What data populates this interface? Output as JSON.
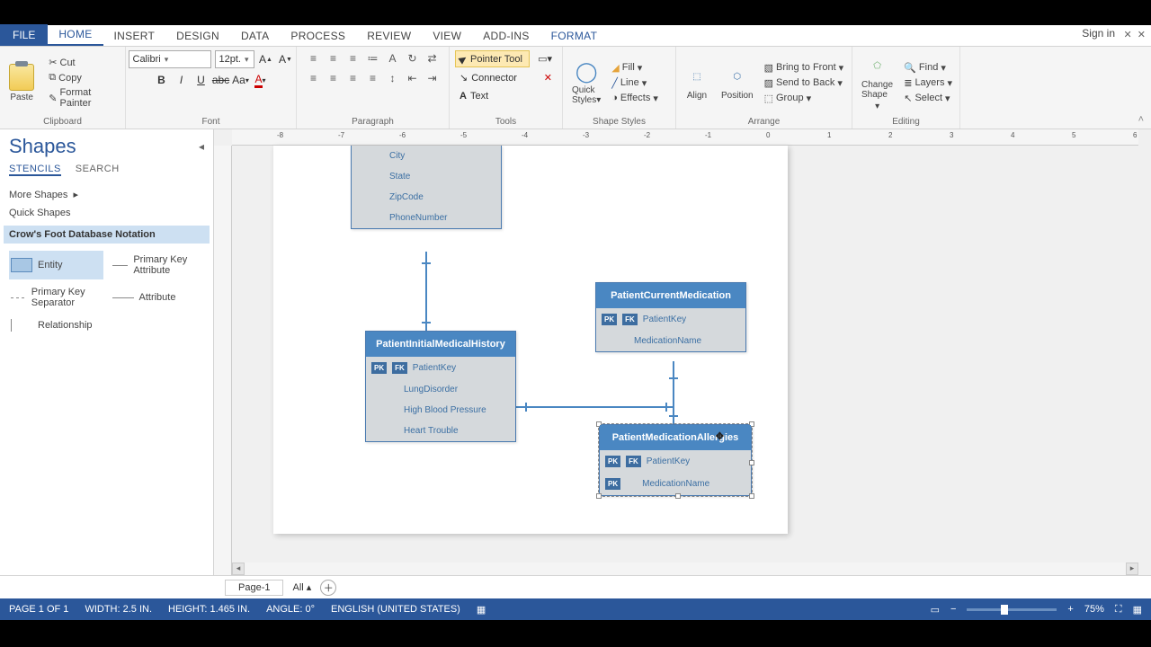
{
  "tabs": {
    "file": "FILE",
    "list": [
      "HOME",
      "INSERT",
      "DESIGN",
      "DATA",
      "PROCESS",
      "REVIEW",
      "VIEW",
      "ADD-INS",
      "FORMAT"
    ],
    "active": 0
  },
  "signin": "Sign in",
  "ribbon": {
    "clipboard": {
      "paste": "Paste",
      "cut": "Cut",
      "copy": "Copy",
      "painter": "Format Painter",
      "label": "Clipboard"
    },
    "font": {
      "name": "Calibri",
      "size": "12pt.",
      "label": "Font"
    },
    "paragraph": {
      "label": "Paragraph"
    },
    "tools": {
      "pointer": "Pointer Tool",
      "connector": "Connector",
      "text": "Text",
      "label": "Tools"
    },
    "shapestyles": {
      "fill": "Fill",
      "line": "Line",
      "effects": "Effects",
      "label": "Shape Styles"
    },
    "arrange": {
      "align": "Align",
      "position": "Position",
      "front": "Bring to Front",
      "back": "Send to Back",
      "group": "Group",
      "label": "Arrange"
    },
    "editing": {
      "change": "Change Shape",
      "find": "Find",
      "layers": "Layers",
      "select": "Select",
      "label": "Editing"
    }
  },
  "shapesPane": {
    "title": "Shapes",
    "tab1": "STENCILS",
    "tab2": "SEARCH",
    "more": "More Shapes",
    "quick": "Quick Shapes",
    "stencil": "Crow's Foot Database Notation",
    "items": [
      "Entity",
      "Primary Key Attribute",
      "Primary Key Separator",
      "Attribute",
      "Relationship"
    ]
  },
  "canvas": {
    "rulerMarks": [
      "-8",
      "-7",
      "-6",
      "-5",
      "-4",
      "-3",
      "-2",
      "-1",
      "0",
      "1",
      "2",
      "3",
      "4",
      "5",
      "6"
    ],
    "entities": {
      "top": {
        "rows": [
          "City",
          "State",
          "ZipCode",
          "PhoneNumber"
        ]
      },
      "history": {
        "title": "PatientInitialMedicalHistory",
        "key": "PatientKey",
        "rows": [
          "LungDisorder",
          "High Blood Pressure",
          "Heart Trouble"
        ]
      },
      "medication": {
        "title": "PatientCurrentMedication",
        "key": "PatientKey",
        "rows": [
          "MedicationName"
        ]
      },
      "allergies": {
        "title": "PatientMedicationAllergies",
        "key": "PatientKey",
        "rows": [
          "MedicationName"
        ]
      }
    }
  },
  "pagetabs": {
    "page": "Page-1",
    "all": "All"
  },
  "status": {
    "page": "PAGE 1 OF 1",
    "width": "WIDTH: 2.5 IN.",
    "height": "HEIGHT: 1.465 IN.",
    "angle": "ANGLE: 0°",
    "lang": "ENGLISH (UNITED STATES)",
    "zoom": "75%"
  }
}
